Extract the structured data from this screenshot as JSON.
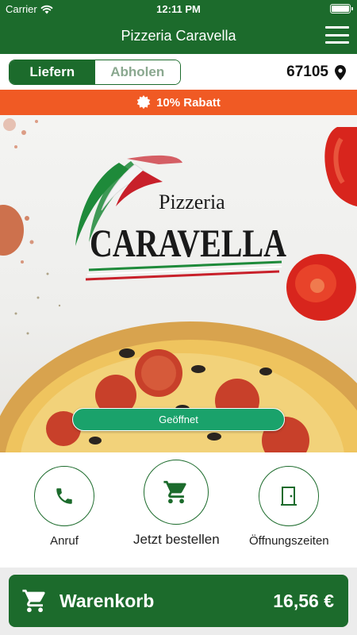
{
  "status_bar": {
    "carrier": "Carrier",
    "time": "12:11 PM"
  },
  "header": {
    "title": "Pizzeria Caravella",
    "menu_icon": "hamburger-menu-icon"
  },
  "mode_switch": {
    "options": [
      "Liefern",
      "Abholen"
    ],
    "selected": "Liefern"
  },
  "location": {
    "zipcode": "67105",
    "icon": "location-pin-icon"
  },
  "discount_banner": {
    "label": "10% Rabatt",
    "icon": "badge-icon"
  },
  "hero": {
    "logo_top": "Pizzeria",
    "logo_main": "CARAVELLA",
    "status": "Geöffnet"
  },
  "actions": [
    {
      "label": "Anruf",
      "icon": "phone-icon"
    },
    {
      "label": "Jetzt bestellen",
      "icon": "shopping-cart-icon"
    },
    {
      "label": "Öffnungszeiten",
      "icon": "door-icon"
    }
  ],
  "cart": {
    "label": "Warenkorb",
    "total": "16,56 €",
    "icon": "shopping-cart-icon"
  },
  "colors": {
    "primary_green": "#1c6b2c",
    "discount_orange": "#f05a24",
    "open_green": "#1aa26b"
  }
}
